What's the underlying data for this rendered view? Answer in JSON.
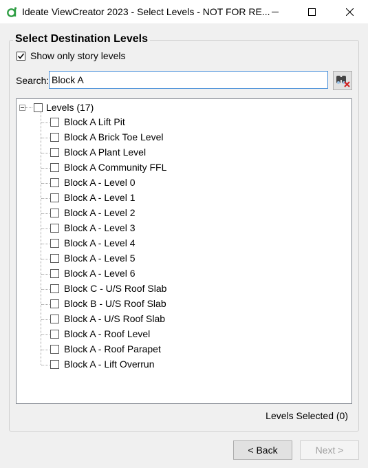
{
  "window": {
    "title": "Ideate ViewCreator 2023 - Select Levels - NOT FOR RE...",
    "accent_color": "#2f9e44"
  },
  "group": {
    "title": "Select Destination Levels",
    "show_story_label": "Show only story levels",
    "show_story_checked": true
  },
  "search": {
    "label": "Search:",
    "value": "Block A",
    "clear_icon": "binoculars-clear-icon"
  },
  "tree": {
    "root_label": "Levels (17)",
    "root_checked": false,
    "items": [
      {
        "label": "Block A Lift Pit",
        "checked": false
      },
      {
        "label": "Block A Brick Toe Level",
        "checked": false
      },
      {
        "label": "Block A Plant Level",
        "checked": false
      },
      {
        "label": "Block A Community FFL",
        "checked": false
      },
      {
        "label": "Block A - Level 0",
        "checked": false
      },
      {
        "label": "Block A - Level 1",
        "checked": false
      },
      {
        "label": "Block A - Level 2",
        "checked": false
      },
      {
        "label": "Block A - Level 3",
        "checked": false
      },
      {
        "label": "Block A - Level 4",
        "checked": false
      },
      {
        "label": "Block A - Level 5",
        "checked": false
      },
      {
        "label": "Block A - Level 6",
        "checked": false
      },
      {
        "label": "Block C - U/S Roof Slab",
        "checked": false
      },
      {
        "label": "Block B - U/S Roof Slab",
        "checked": false
      },
      {
        "label": "Block A - U/S Roof Slab",
        "checked": false
      },
      {
        "label": "Block A - Roof Level",
        "checked": false
      },
      {
        "label": "Block A - Roof Parapet",
        "checked": false
      },
      {
        "label": "Block A - Lift Overrun",
        "checked": false
      }
    ]
  },
  "status": {
    "levels_selected": "Levels Selected (0)"
  },
  "buttons": {
    "back": "< Back",
    "next": "Next >",
    "next_enabled": false
  }
}
